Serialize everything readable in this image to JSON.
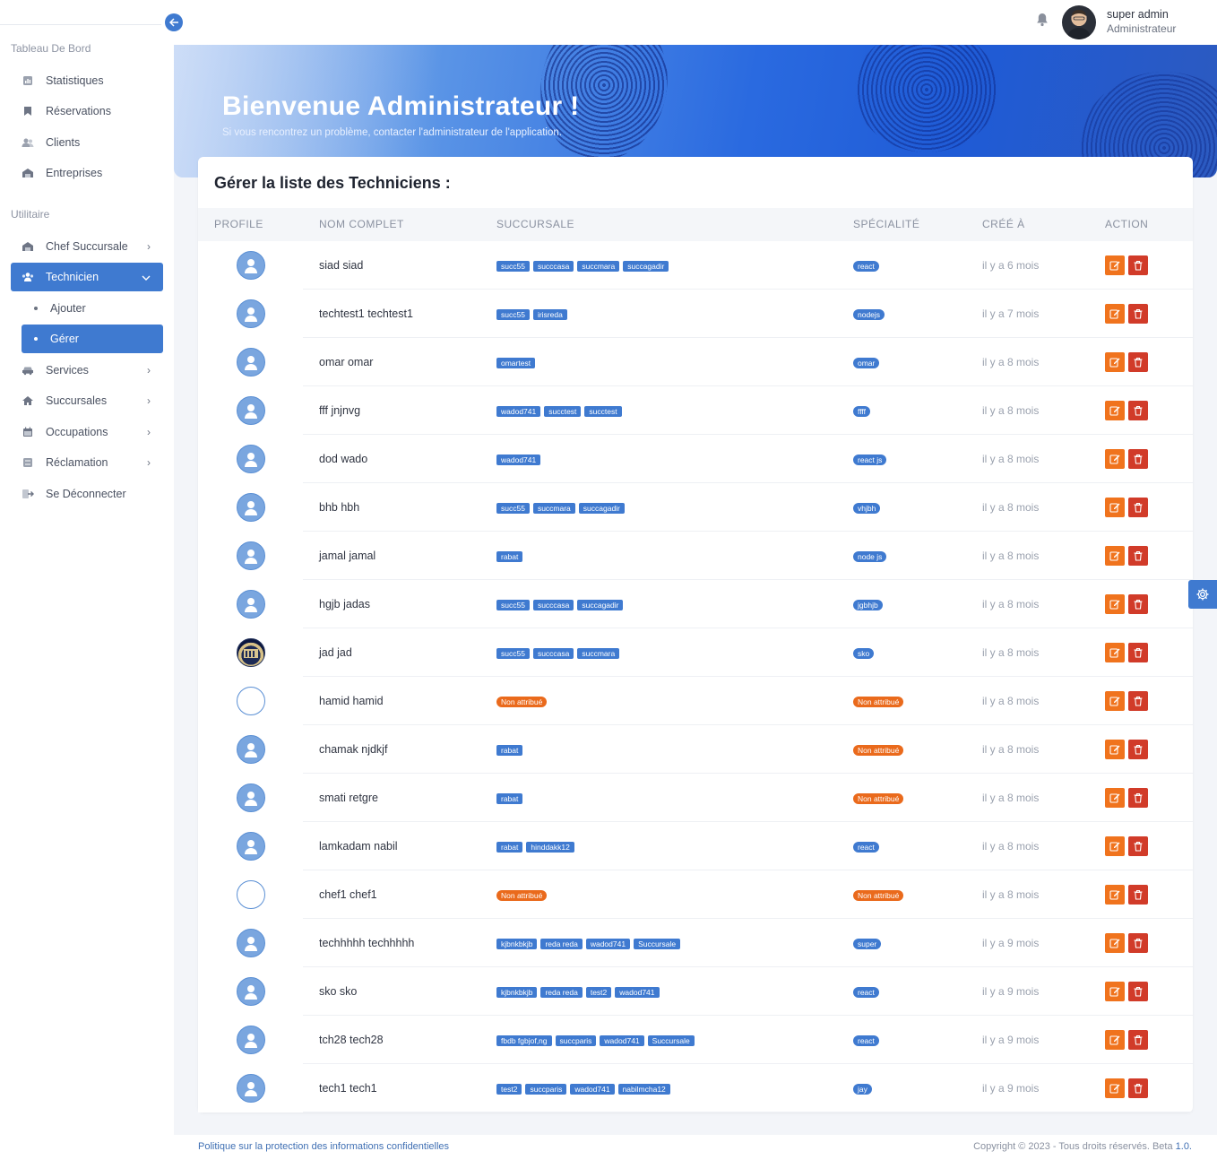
{
  "sidebar": {
    "section_dashboard": "Tableau De Bord",
    "section_utility": "Utilitaire",
    "items": [
      {
        "label": "Statistiques",
        "icon": "chart-icon"
      },
      {
        "label": "Réservations",
        "icon": "bookmark-icon"
      },
      {
        "label": "Clients",
        "icon": "users-icon"
      },
      {
        "label": "Entreprises",
        "icon": "building-icon"
      },
      {
        "label": "Chef Succursale",
        "icon": "building-icon"
      },
      {
        "label": "Technicien",
        "icon": "users-icon"
      },
      {
        "label": "Ajouter"
      },
      {
        "label": "Gérer"
      },
      {
        "label": "Services",
        "icon": "car-icon"
      },
      {
        "label": "Succursales",
        "icon": "home-icon"
      },
      {
        "label": "Occupations",
        "icon": "calendar-icon"
      },
      {
        "label": "Réclamation",
        "icon": "sliders-icon"
      },
      {
        "label": "Se Déconnecter",
        "icon": "logout-icon"
      }
    ]
  },
  "topbar": {
    "user_name": "super admin",
    "user_role": "Administrateur"
  },
  "hero": {
    "title": "Bienvenue Administrateur !",
    "subtitle": "Si vous rencontrez un problème, contacter l'administrateur de l'application."
  },
  "card": {
    "title": "Gérer la liste des Techniciens :",
    "columns": [
      "PROFILE",
      "NOM COMPLET",
      "SUCCURSALE",
      "SPÉCIALITÉ",
      "CRÉÉ À",
      "ACTION"
    ]
  },
  "technicians": [
    {
      "name": "siad siad",
      "avatar": "default",
      "branches": [
        "succ55",
        "succcasa",
        "succmara",
        "succagadir"
      ],
      "branch_unassigned": false,
      "specialty": "react",
      "specialty_unassigned": false,
      "created": "il y a 6 mois"
    },
    {
      "name": "techtest1 techtest1",
      "avatar": "default",
      "branches": [
        "succ55",
        "irisreda"
      ],
      "branch_unassigned": false,
      "specialty": "nodejs",
      "specialty_unassigned": false,
      "created": "il y a 7 mois"
    },
    {
      "name": "omar omar",
      "avatar": "default",
      "branches": [
        "omartest"
      ],
      "branch_unassigned": false,
      "specialty": "omar",
      "specialty_unassigned": false,
      "created": "il y a 8 mois"
    },
    {
      "name": "fff jnjnvg",
      "avatar": "default",
      "branches": [
        "wadod741",
        "succtest",
        "succtest"
      ],
      "branch_unassigned": false,
      "specialty": "ffff",
      "specialty_unassigned": false,
      "created": "il y a 8 mois"
    },
    {
      "name": "dod wado",
      "avatar": "default",
      "branches": [
        "wadod741"
      ],
      "branch_unassigned": false,
      "specialty": "react js",
      "specialty_unassigned": false,
      "created": "il y a 8 mois"
    },
    {
      "name": "bhb hbh",
      "avatar": "default",
      "branches": [
        "succ55",
        "succmara",
        "succagadir"
      ],
      "branch_unassigned": false,
      "specialty": "vhjbh",
      "specialty_unassigned": false,
      "created": "il y a 8 mois"
    },
    {
      "name": "jamal jamal",
      "avatar": "default",
      "branches": [
        "rabat"
      ],
      "branch_unassigned": false,
      "specialty": "node js",
      "specialty_unassigned": false,
      "created": "il y a 8 mois"
    },
    {
      "name": "hgjb jadas",
      "avatar": "default",
      "branches": [
        "succ55",
        "succcasa",
        "succagadir"
      ],
      "branch_unassigned": false,
      "specialty": "jgbhjb",
      "specialty_unassigned": false,
      "created": "il y a 8 mois"
    },
    {
      "name": "jad jad",
      "avatar": "photo",
      "branches": [
        "succ55",
        "succcasa",
        "succmara"
      ],
      "branch_unassigned": false,
      "specialty": "sko",
      "specialty_unassigned": false,
      "created": "il y a 8 mois"
    },
    {
      "name": "hamid hamid",
      "avatar": "empty",
      "branches": [
        "Non attribué"
      ],
      "branch_unassigned": true,
      "specialty": "Non attribué",
      "specialty_unassigned": true,
      "created": "il y a 8 mois"
    },
    {
      "name": "chamak njdkjf",
      "avatar": "default",
      "branches": [
        "rabat"
      ],
      "branch_unassigned": false,
      "specialty": "Non attribué",
      "specialty_unassigned": true,
      "created": "il y a 8 mois"
    },
    {
      "name": "smati retgre",
      "avatar": "default",
      "branches": [
        "rabat"
      ],
      "branch_unassigned": false,
      "specialty": "Non attribué",
      "specialty_unassigned": true,
      "created": "il y a 8 mois"
    },
    {
      "name": "lamkadam nabil",
      "avatar": "default",
      "branches": [
        "rabat",
        "hinddakk12"
      ],
      "branch_unassigned": false,
      "specialty": "react",
      "specialty_unassigned": false,
      "created": "il y a 8 mois"
    },
    {
      "name": "chef1 chef1",
      "avatar": "empty",
      "branches": [
        "Non attribué"
      ],
      "branch_unassigned": true,
      "specialty": "Non attribué",
      "specialty_unassigned": true,
      "created": "il y a 8 mois"
    },
    {
      "name": "techhhhh techhhhh",
      "avatar": "default",
      "branches": [
        "kjbnkbkjb",
        "reda reda",
        "wadod741",
        "Succursale"
      ],
      "branch_unassigned": false,
      "specialty": "super",
      "specialty_unassigned": false,
      "created": "il y a 9 mois"
    },
    {
      "name": "sko sko",
      "avatar": "default",
      "branches": [
        "kjbnkbkjb",
        "reda reda",
        "test2",
        "wadod741"
      ],
      "branch_unassigned": false,
      "specialty": "react",
      "specialty_unassigned": false,
      "created": "il y a 9 mois"
    },
    {
      "name": "tch28 tech28",
      "avatar": "default",
      "branches": [
        "fbdb fgbjof,ng",
        "succparis",
        "wadod741",
        "Succursale"
      ],
      "branch_unassigned": false,
      "specialty": "react",
      "specialty_unassigned": false,
      "created": "il y a 9 mois"
    },
    {
      "name": "tech1 tech1",
      "avatar": "default",
      "branches": [
        "test2",
        "succparis",
        "wadod741",
        "nabilmcha12"
      ],
      "branch_unassigned": false,
      "specialty": "jay",
      "specialty_unassigned": false,
      "created": "il y a 9 mois"
    }
  ],
  "footer": {
    "privacy_link": "Politique sur la protection des informations confidentielles",
    "copyright": "Copyright © 2023 - Tous droits réservés. Beta",
    "version": "1.0."
  },
  "colors": {
    "accent": "#3f7ad0",
    "warning": "#ea6a1c",
    "edit": "#f0731d",
    "delete": "#d13b29"
  }
}
